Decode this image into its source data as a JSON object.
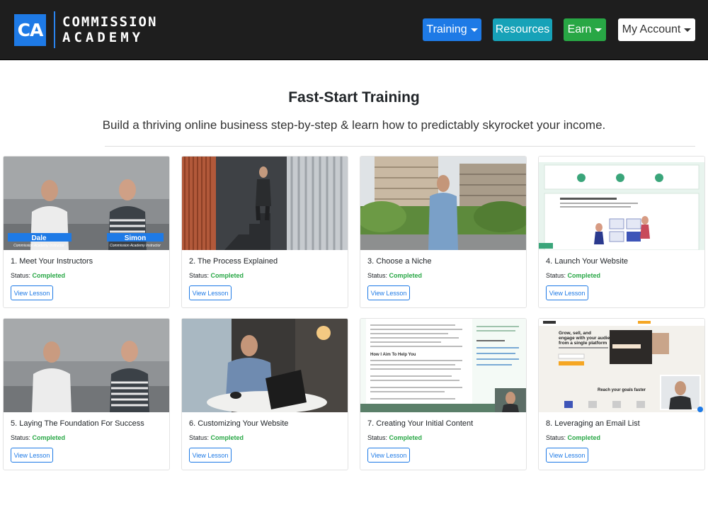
{
  "brand": {
    "logo_initials": "CA",
    "logo_line1": "COMMISSION",
    "logo_line2": "ACADEMY"
  },
  "nav": {
    "training": "Training",
    "resources": "Resources",
    "earn": "Earn",
    "account": "My Account"
  },
  "colors": {
    "navbar": "#1e1e1e",
    "primary": "#1e7ae6",
    "info": "#17a2b8",
    "success": "#28a745",
    "light": "#ffffff"
  },
  "page": {
    "title": "Fast-Start Training",
    "subtitle": "Build a thriving online business step-by-step & learn how to predictably skyrocket your income."
  },
  "status_label": "Status:",
  "lessons": [
    {
      "title": "1. Meet Your Instructors",
      "status": "Completed",
      "button": "View Lesson",
      "captions": [
        "Dale",
        "Simon"
      ],
      "caption_sub": [
        "Commission Academy Instructor",
        "Commission Academy Instructor"
      ]
    },
    {
      "title": "2. The Process Explained",
      "status": "Completed",
      "button": "View Lesson"
    },
    {
      "title": "3. Choose a Niche",
      "status": "Completed",
      "button": "View Lesson"
    },
    {
      "title": "4. Launch Your Website",
      "status": "Completed",
      "button": "View Lesson"
    },
    {
      "title": "5. Laying The Foundation For Success",
      "status": "Completed",
      "button": "View Lesson"
    },
    {
      "title": "6. Customizing Your Website",
      "status": "Completed",
      "button": "View Lesson"
    },
    {
      "title": "7. Creating Your Initial Content",
      "status": "Completed",
      "button": "View Lesson",
      "thumb_heading": "How I Aim To Help You"
    },
    {
      "title": "8. Leveraging an Email List",
      "status": "Completed",
      "button": "View Lesson",
      "thumb_heading": "Grow, sell, and engage with your audience—all from a single platform",
      "thumb_sub": "Reach your goals faster"
    }
  ]
}
